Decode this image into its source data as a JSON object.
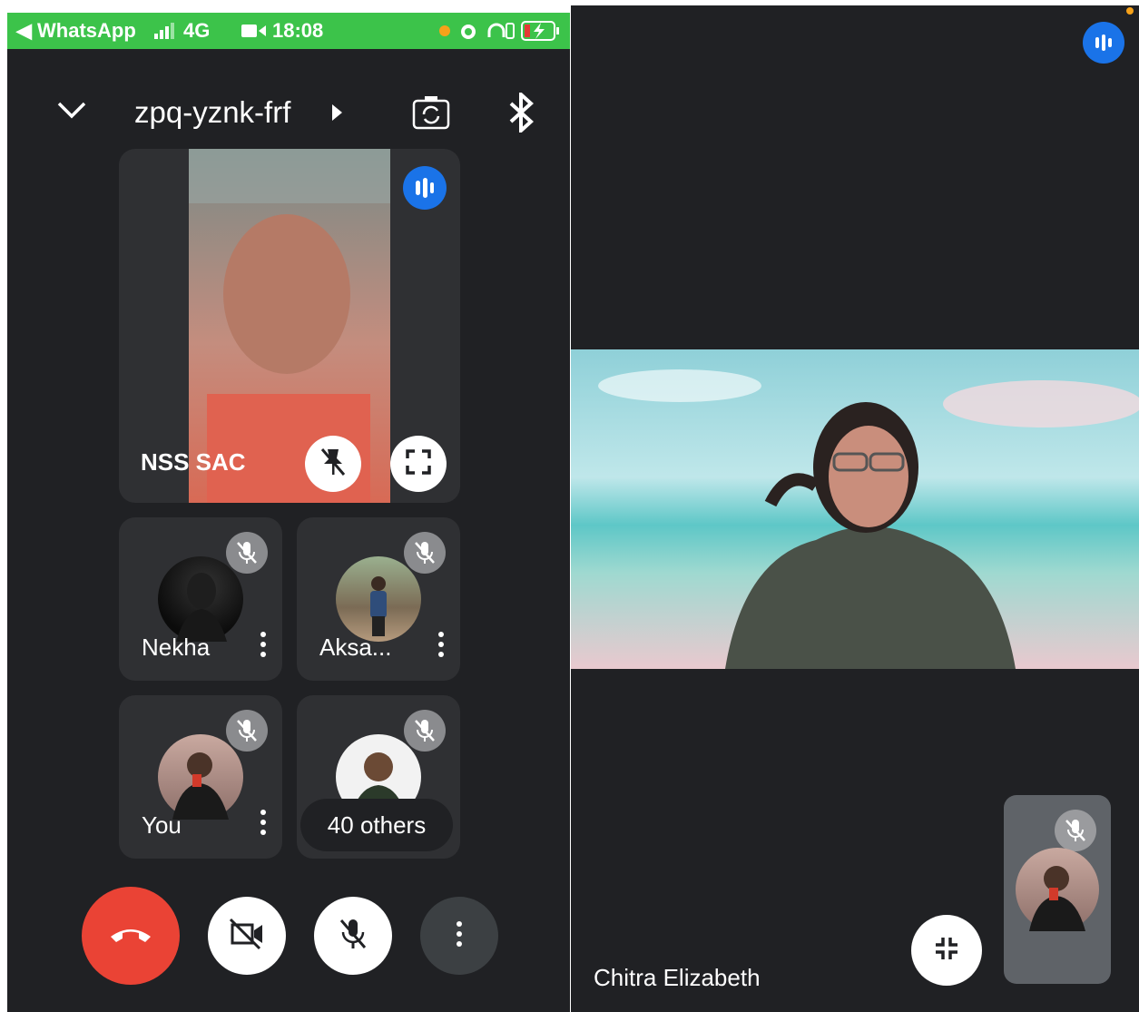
{
  "status_bar": {
    "back_app": "◀ WhatsApp",
    "network": "4G",
    "time": "18:08",
    "bg_color": "#3cc34a"
  },
  "header": {
    "meeting_code": "zpq-yznk-frf",
    "icons": [
      "chevron-down-icon",
      "switch-camera-icon",
      "bluetooth-icon"
    ]
  },
  "main_tile": {
    "name": "NSS SAC",
    "speaking": true
  },
  "participants": [
    {
      "name": "Nekha",
      "muted": true
    },
    {
      "name": "Aksa...",
      "muted": true
    },
    {
      "name": "You",
      "muted": true
    },
    {
      "label": "40 others",
      "muted": true
    }
  ],
  "controls": {
    "end_call_color": "#ea4335",
    "buttons": [
      "end-call",
      "camera-off",
      "mic-off",
      "more-options"
    ]
  },
  "right_screen": {
    "presenter_name": "Chitra Elizabeth",
    "speaking": true,
    "self_view_muted": true
  },
  "colors": {
    "background": "#202124",
    "tile": "#2f3033",
    "accent_blue": "#1a73e8"
  }
}
